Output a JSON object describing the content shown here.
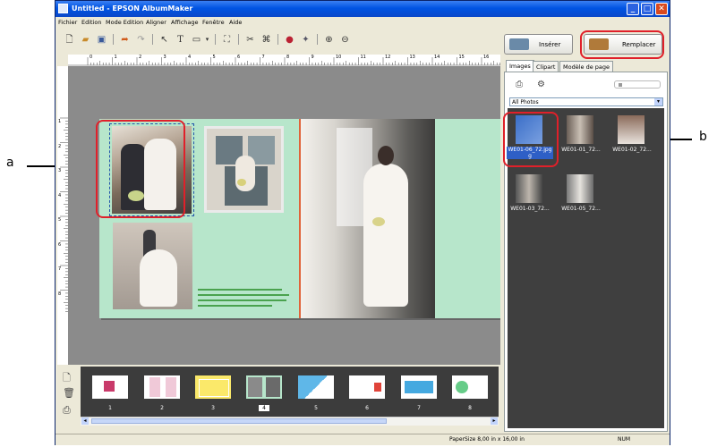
{
  "window": {
    "title": "Untitled - EPSON AlbumMaker",
    "min": "_",
    "max": "□",
    "close": "✕"
  },
  "menu": [
    "Fichier",
    "Edition",
    "Mode Edition",
    "Aligner",
    "Affichage",
    "Fenêtre",
    "Aide"
  ],
  "toolbar_icons": [
    "new-icon",
    "open-icon",
    "save-icon",
    "undo-icon",
    "redo-icon",
    "pointer-icon",
    "text-icon",
    "shape-icon",
    "frame-icon",
    "crop-icon",
    "clip-icon",
    "color-icon",
    "effect-icon",
    "zoom-in-icon",
    "zoom-out-icon"
  ],
  "ruler_h": [
    "0",
    "1",
    "2",
    "3",
    "4",
    "5",
    "6",
    "7",
    "8",
    "9",
    "10",
    "11",
    "12",
    "13",
    "14",
    "15",
    "16"
  ],
  "ruler_v": [
    "1",
    "2",
    "3",
    "4",
    "5",
    "6",
    "7",
    "8"
  ],
  "panel": {
    "insert_label": "Insérer",
    "replace_label": "Remplacer",
    "tabs": [
      "Images",
      "Clipart",
      "Modèle de page"
    ],
    "filter_value": "All Photos",
    "thumbnails": [
      {
        "caption": "WE01-06_72.jpg",
        "caption2": "g",
        "selected": true
      },
      {
        "caption": "WE01-01_72...",
        "selected": false
      },
      {
        "caption": "WE01-02_72...",
        "selected": false
      },
      {
        "caption": "WE01-03_72...",
        "selected": false
      },
      {
        "caption": "WE01-05_72...",
        "selected": false
      }
    ]
  },
  "filmstrip": {
    "pages": [
      "1",
      "2",
      "3",
      "4",
      "5",
      "6",
      "7",
      "8"
    ],
    "current": "4"
  },
  "status": {
    "paper": "PaperSize  8,00 in x 16,00 in",
    "num": "NUM"
  },
  "annotations": {
    "a": "a",
    "b": "b"
  }
}
